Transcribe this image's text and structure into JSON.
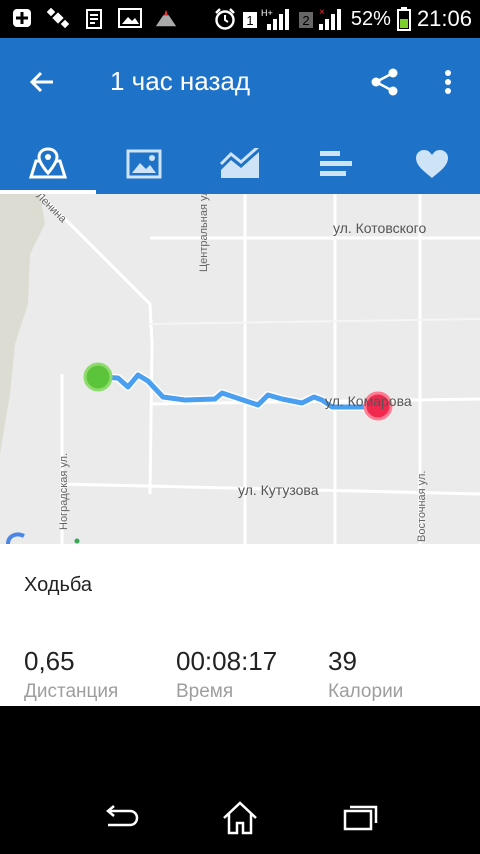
{
  "status_bar": {
    "battery_percent": "52%",
    "time": "21:06",
    "sim1": "1",
    "sim2": "2",
    "network": "H+"
  },
  "app_bar": {
    "title": "1 час назад",
    "back_icon": "arrow-back-icon",
    "share_icon": "share-icon",
    "more_icon": "more-vert-icon",
    "accent": "#1e73c9"
  },
  "tabs": [
    {
      "icon": "map-icon",
      "selected": true
    },
    {
      "icon": "photo-icon",
      "selected": false
    },
    {
      "icon": "chart-icon",
      "selected": false
    },
    {
      "icon": "bars-icon",
      "selected": false
    },
    {
      "icon": "heart-icon",
      "selected": false
    }
  ],
  "map": {
    "streets": {
      "kotovskogo": "ул. Котовского",
      "komarova": "ул. Комарова",
      "kutuzova": "ул. Кутузова",
      "centralnaya": "Центральная ул.",
      "nogradskaya": "Ноградская ул.",
      "vostochnaya": "Восточная ул.",
      "lenina": "Ленина"
    },
    "start_color": "#5cc43a",
    "end_color": "#f2294e",
    "route_color": "#4a9ff0"
  },
  "activity": {
    "name": "Ходьба",
    "stats": [
      {
        "value": "0,65",
        "label": "Дистанция"
      },
      {
        "value": "00:08:17",
        "label": "Время"
      },
      {
        "value": "39",
        "label": "Калории"
      }
    ]
  },
  "nav": {
    "back_icon": "nav-back-icon",
    "home_icon": "nav-home-icon",
    "recents_icon": "nav-recents-icon"
  }
}
